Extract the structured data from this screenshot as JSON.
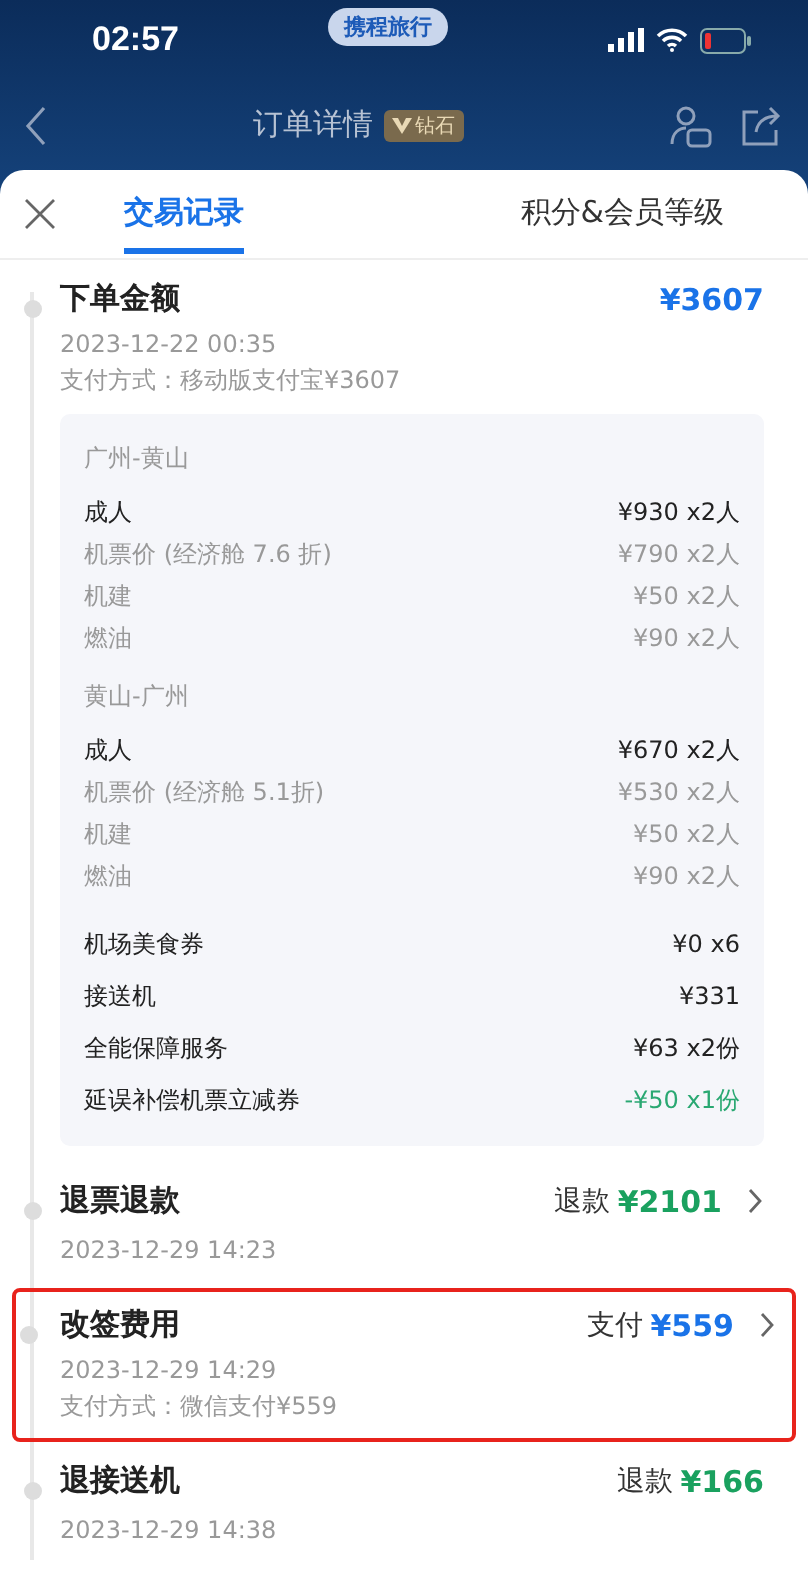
{
  "status_bar": {
    "time": "02:57",
    "app_pill": "携程旅行"
  },
  "header": {
    "title": "订单详情",
    "badge": "钻石"
  },
  "tabs": [
    {
      "label": "交易记录",
      "selected": true
    },
    {
      "label": "积分&会员等级",
      "selected": false
    }
  ],
  "entries": [
    {
      "title": "下单金额",
      "amount": "¥3607",
      "color": "#1a73e8",
      "chevron": false,
      "highlighted": false,
      "time": "2023-12-22 00:35",
      "payment": "支付方式：移动版支付宝¥3607",
      "breakdown": {
        "segments": [
          {
            "route": "广州-黄山",
            "rows": [
              {
                "label": "成人",
                "value": "¥930 x2人",
                "kind": "main"
              },
              {
                "label": "机票价 (经济舱 7.6 折)",
                "value": "¥790 x2人",
                "kind": "sub"
              },
              {
                "label": "机建",
                "value": "¥50 x2人",
                "kind": "sub"
              },
              {
                "label": "燃油",
                "value": "¥90 x2人",
                "kind": "sub"
              }
            ]
          },
          {
            "route": "黄山-广州",
            "rows": [
              {
                "label": "成人",
                "value": "¥670 x2人",
                "kind": "main"
              },
              {
                "label": "机票价 (经济舱 5.1折)",
                "value": "¥530 x2人",
                "kind": "sub"
              },
              {
                "label": "机建",
                "value": "¥50 x2人",
                "kind": "sub"
              },
              {
                "label": "燃油",
                "value": "¥90 x2人",
                "kind": "sub"
              }
            ]
          }
        ],
        "extras": [
          {
            "label": "机场美食券",
            "value": "¥0 x6",
            "kind": "main"
          },
          {
            "label": "接送机",
            "value": "¥331",
            "kind": "main"
          },
          {
            "label": "全能保障服务",
            "value": "¥63 x2份",
            "kind": "main"
          },
          {
            "label": "延误补偿机票立减券",
            "value": "-¥50 x1份",
            "kind": "discount"
          }
        ]
      }
    },
    {
      "title": "退票退款",
      "amount_prefix": "退款",
      "amount": "¥2101",
      "color": "#1aa15f",
      "chevron": true,
      "highlighted": false,
      "time": "2023-12-29 14:23"
    },
    {
      "title": "改签费用",
      "amount_prefix": "支付",
      "amount": "¥559",
      "color": "#1a73e8",
      "chevron": true,
      "highlighted": true,
      "time": "2023-12-29 14:29",
      "payment": "支付方式：微信支付¥559"
    },
    {
      "title": "退接送机",
      "amount_prefix": "退款",
      "amount": "¥166",
      "color": "#1aa15f",
      "chevron": false,
      "highlighted": false,
      "time": "2023-12-29 14:38"
    }
  ]
}
